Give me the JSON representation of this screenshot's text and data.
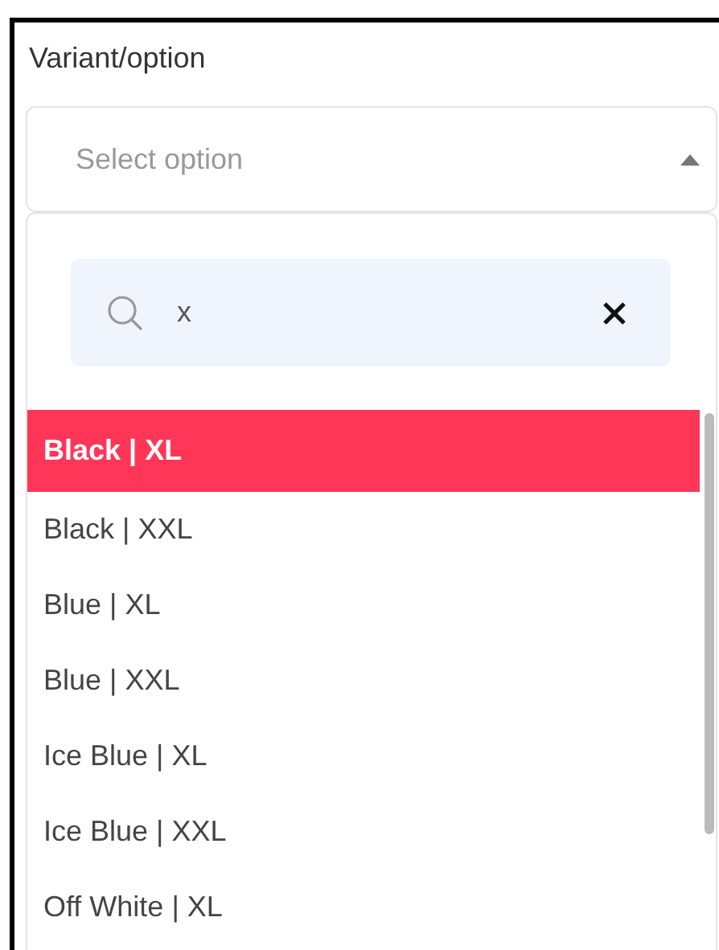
{
  "field_label": "Variant/option",
  "select": {
    "placeholder": "Select option",
    "expanded": true
  },
  "search": {
    "value": "x"
  },
  "options": [
    {
      "label": "Black | XL",
      "selected": true
    },
    {
      "label": "Black | XXL",
      "selected": false
    },
    {
      "label": "Blue | XL",
      "selected": false
    },
    {
      "label": "Blue | XXL",
      "selected": false
    },
    {
      "label": "Ice Blue | XL",
      "selected": false
    },
    {
      "label": "Ice Blue | XXL",
      "selected": false
    },
    {
      "label": "Off White | XL",
      "selected": false
    }
  ]
}
